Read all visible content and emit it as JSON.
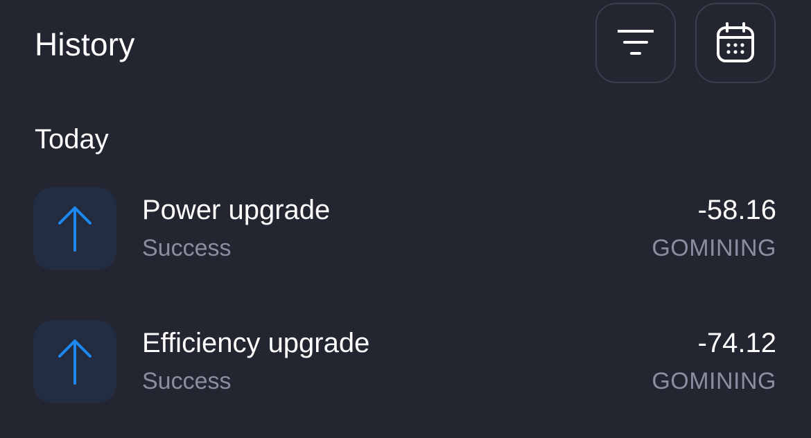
{
  "header": {
    "title": "History",
    "filter_icon": "filter-icon",
    "calendar_icon": "calendar-icon"
  },
  "section": {
    "label": "Today"
  },
  "transactions": [
    {
      "title": "Power upgrade",
      "status": "Success",
      "amount": "-58.16",
      "currency": "GOMINING",
      "icon": "arrow-up-icon"
    },
    {
      "title": "Efficiency upgrade",
      "status": "Success",
      "amount": "-74.12",
      "currency": "GOMINING",
      "icon": "arrow-up-icon"
    }
  ],
  "colors": {
    "background": "#232530",
    "accent": "#1e88f0",
    "tile": "#232d42",
    "muted_text": "#8b8ea0",
    "button_border": "#3a3d4a"
  }
}
